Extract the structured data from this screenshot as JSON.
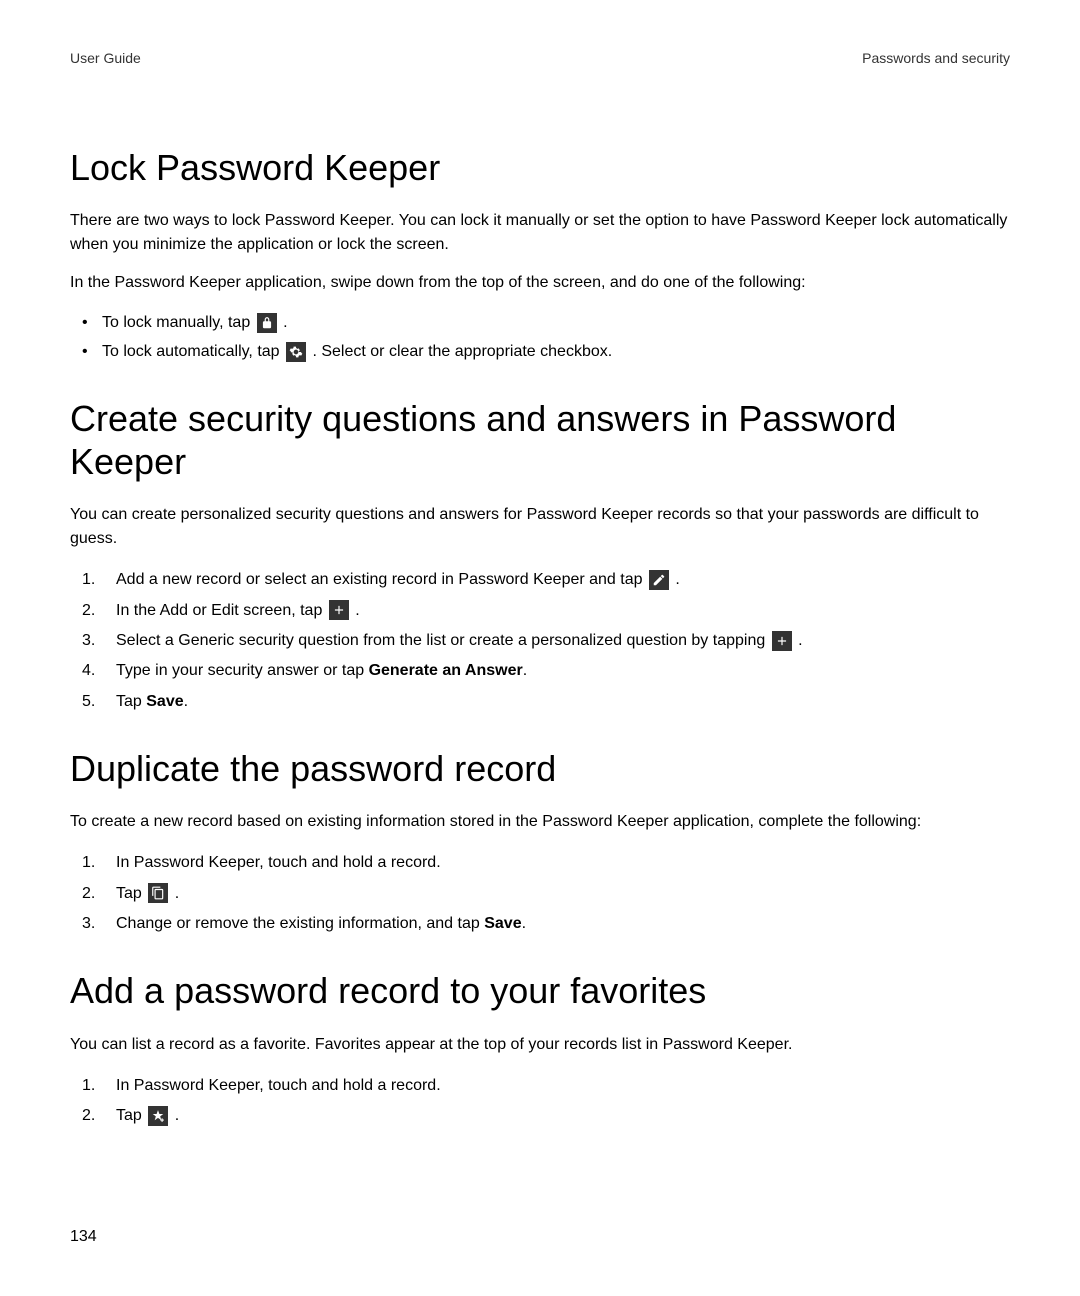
{
  "header": {
    "left": "User Guide",
    "right": "Passwords and security"
  },
  "section1": {
    "title": "Lock Password Keeper",
    "p1": "There are two ways to lock Password Keeper. You can lock it manually or set the option to have Password Keeper lock automatically when you minimize the application or lock the screen.",
    "p2": "In the Password Keeper application, swipe down from the top of the screen, and do one of the following:",
    "bullet1_a": "To lock manually, tap ",
    "bullet1_b": " .",
    "bullet2_a": "To lock automatically, tap ",
    "bullet2_b": " . Select or clear the appropriate checkbox."
  },
  "section2": {
    "title": "Create security questions and answers in Password Keeper",
    "p1": "You can create personalized security questions and answers for Password Keeper records so that your passwords are difficult to guess.",
    "step1_a": "Add a new record or select an existing record in Password Keeper and tap ",
    "step1_b": " .",
    "step2_a": "In the Add or Edit screen, tap ",
    "step2_b": " .",
    "step3_a": "Select a Generic security question from the list or create a personalized question by tapping ",
    "step3_b": " .",
    "step4_a": "Type in your security answer or tap ",
    "step4_bold": "Generate an Answer",
    "step4_b": ".",
    "step5_a": "Tap ",
    "step5_bold": "Save",
    "step5_b": "."
  },
  "section3": {
    "title": "Duplicate the password record",
    "p1": "To create a new record based on existing information stored in the Password Keeper application, complete the following:",
    "step1": "In Password Keeper, touch and hold a record.",
    "step2_a": "Tap ",
    "step2_b": " .",
    "step3_a": "Change or remove the existing information, and tap ",
    "step3_bold": "Save",
    "step3_b": "."
  },
  "section4": {
    "title": "Add a password record to your favorites",
    "p1": "You can list a record as a favorite. Favorites appear at the top of your records list in Password Keeper.",
    "step1": "In Password Keeper, touch and hold a record.",
    "step2_a": "Tap ",
    "step2_b": " ."
  },
  "page_number": "134"
}
